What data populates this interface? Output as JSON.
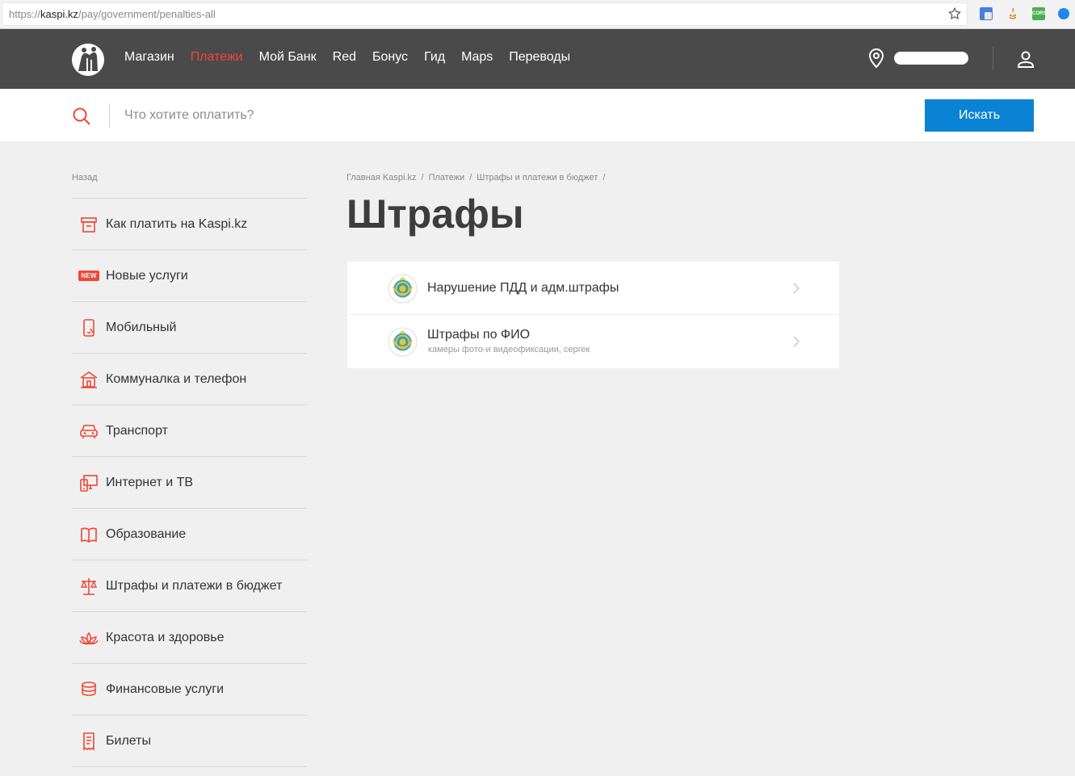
{
  "browser": {
    "url_scheme": "https://",
    "url_host": "kaspi.kz",
    "url_path": "/pay/government/penalties-all",
    "extensions": [
      "google-translate-icon",
      "java-icon",
      "cors-icon",
      "check-icon"
    ],
    "cors_label": "CORS"
  },
  "nav": {
    "links": [
      "Магазин",
      "Платежи",
      "Мой Банк",
      "Red",
      "Бонус",
      "Гид",
      "Maps",
      "Переводы"
    ],
    "active_index": 1
  },
  "search": {
    "placeholder": "Что хотите оплатить?",
    "button_label": "Искать"
  },
  "sidebar": {
    "back_label": "Назад",
    "items": [
      {
        "label": "Как платить на Kaspi.kz",
        "icon": "register-icon"
      },
      {
        "label": "Новые услуги",
        "icon": "new-badge",
        "badge": "NEW"
      },
      {
        "label": "Мобильный",
        "icon": "mobile-icon"
      },
      {
        "label": "Коммуналка и телефон",
        "icon": "house-icon"
      },
      {
        "label": "Транспорт",
        "icon": "car-icon"
      },
      {
        "label": "Интернет и ТВ",
        "icon": "internet-tv-icon"
      },
      {
        "label": "Образование",
        "icon": "book-icon"
      },
      {
        "label": "Штрафы и платежи в бюджет",
        "icon": "scales-icon"
      },
      {
        "label": "Красота и здоровье",
        "icon": "lotus-icon"
      },
      {
        "label": "Финансовые услуги",
        "icon": "coins-icon"
      },
      {
        "label": "Билеты",
        "icon": "ticket-icon"
      }
    ]
  },
  "breadcrumb": [
    "Главная Kaspi.kz",
    "Платежи",
    "Штрафы и платежи в бюджет"
  ],
  "page_title": "Штрафы",
  "services": [
    {
      "title": "Нарушение ПДД и адм.штрафы",
      "subtitle": ""
    },
    {
      "title": "Штрафы по ФИО",
      "subtitle": "камеры фото-и видеофиксации, сергек"
    }
  ],
  "colors": {
    "accent_red": "#f14635",
    "nav_bg": "#4a4a4a",
    "button_blue": "#0b83d4",
    "page_bg": "#f0f0f0"
  }
}
